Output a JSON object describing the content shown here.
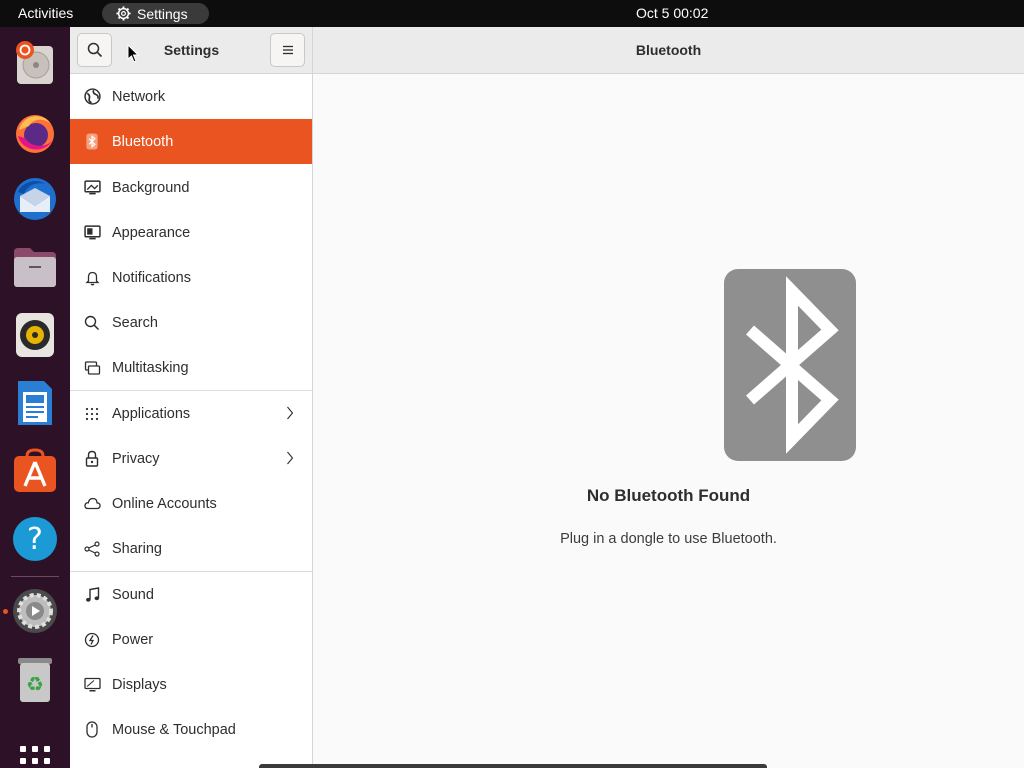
{
  "topbar": {
    "activities_label": "Activities",
    "app_name": "Settings",
    "clock": "Oct 5  00:02"
  },
  "dock": {
    "items": [
      "disk-usage-icon",
      "firefox-icon",
      "thunderbird-icon",
      "files-icon",
      "rhythmbox-icon",
      "libreoffice-writer-icon",
      "app-center-icon",
      "help-icon",
      "settings-icon",
      "trash-icon",
      "show-apps-icon"
    ]
  },
  "window": {
    "sidebar_title": "Settings",
    "page_title": "Bluetooth"
  },
  "sidebar": {
    "items": [
      {
        "label": "Network",
        "icon": "network-icon"
      },
      {
        "label": "Bluetooth",
        "icon": "bluetooth-icon",
        "active": true
      },
      {
        "label": "Background",
        "icon": "background-icon"
      },
      {
        "label": "Appearance",
        "icon": "appearance-icon"
      },
      {
        "label": "Notifications",
        "icon": "bell-icon"
      },
      {
        "label": "Search",
        "icon": "search-icon"
      },
      {
        "label": "Multitasking",
        "icon": "multitasking-icon"
      },
      {
        "label": "Applications",
        "icon": "grid-icon",
        "chevron": true
      },
      {
        "label": "Privacy",
        "icon": "lock-icon",
        "chevron": true
      },
      {
        "label": "Online Accounts",
        "icon": "cloud-icon"
      },
      {
        "label": "Sharing",
        "icon": "share-icon"
      },
      {
        "label": "Sound",
        "icon": "music-note-icon"
      },
      {
        "label": "Power",
        "icon": "power-icon"
      },
      {
        "label": "Displays",
        "icon": "display-icon"
      },
      {
        "label": "Mouse & Touchpad",
        "icon": "mouse-icon"
      }
    ]
  },
  "content": {
    "empty_title": "No Bluetooth Found",
    "empty_subtitle": "Plug in a dongle to use Bluetooth."
  },
  "colors": {
    "accent": "#e95420",
    "dock_bg": "#2d1127",
    "topbar_bg": "#0d0d0d"
  }
}
